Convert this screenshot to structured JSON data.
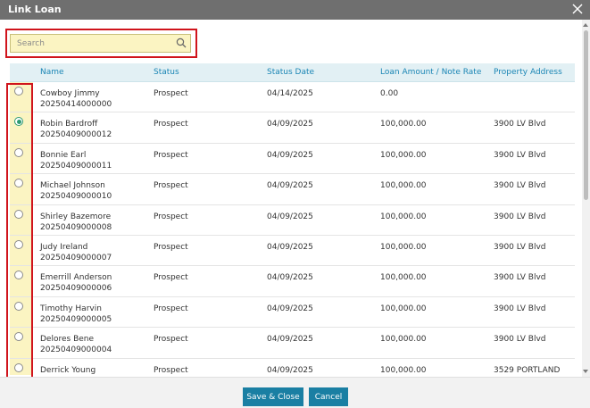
{
  "dialog": {
    "title": "Link Loan"
  },
  "search": {
    "placeholder": "Search"
  },
  "columns": {
    "name": "Name",
    "status": "Status",
    "status_date": "Status Date",
    "loan_amount": "Loan Amount / Note Rate",
    "property_address": "Property Address"
  },
  "rows": [
    {
      "name": "Cowboy Jimmy",
      "id": "20250414000000",
      "status": "Prospect",
      "date": "04/14/2025",
      "amount": "0.00",
      "address": "",
      "selected": false
    },
    {
      "name": "Robin Bardroff",
      "id": "20250409000012",
      "status": "Prospect",
      "date": "04/09/2025",
      "amount": "100,000.00",
      "address": "3900 LV Blvd",
      "selected": true
    },
    {
      "name": "Bonnie Earl",
      "id": "20250409000011",
      "status": "Prospect",
      "date": "04/09/2025",
      "amount": "100,000.00",
      "address": "3900 LV Blvd",
      "selected": false
    },
    {
      "name": "Michael Johnson",
      "id": "20250409000010",
      "status": "Prospect",
      "date": "04/09/2025",
      "amount": "100,000.00",
      "address": "3900 LV Blvd",
      "selected": false
    },
    {
      "name": "Shirley Bazemore",
      "id": "20250409000008",
      "status": "Prospect",
      "date": "04/09/2025",
      "amount": "100,000.00",
      "address": "3900 LV Blvd",
      "selected": false
    },
    {
      "name": "Judy Ireland",
      "id": "20250409000007",
      "status": "Prospect",
      "date": "04/09/2025",
      "amount": "100,000.00",
      "address": "3900 LV Blvd",
      "selected": false
    },
    {
      "name": "Emerrill Anderson",
      "id": "20250409000006",
      "status": "Prospect",
      "date": "04/09/2025",
      "amount": "100,000.00",
      "address": "3900 LV Blvd",
      "selected": false
    },
    {
      "name": "Timothy Harvin",
      "id": "20250409000005",
      "status": "Prospect",
      "date": "04/09/2025",
      "amount": "100,000.00",
      "address": "3900 LV Blvd",
      "selected": false
    },
    {
      "name": "Delores Bene",
      "id": "20250409000004",
      "status": "Prospect",
      "date": "04/09/2025",
      "amount": "100,000.00",
      "address": "3900 LV Blvd",
      "selected": false
    },
    {
      "name": "Derrick Young",
      "id": "",
      "status": "Prospect",
      "date": "04/09/2025",
      "amount": "100,000.00",
      "address": "3529 PORTLAND",
      "selected": false
    }
  ],
  "buttons": {
    "save_close": "Save & Close",
    "cancel": "Cancel"
  },
  "icons": {
    "close": "close-icon",
    "search": "search-icon"
  },
  "colors": {
    "accent": "#1a7fa3",
    "header_text": "#1b86b5",
    "highlight": "#fbf4c2",
    "annotation": "#d0141c",
    "selected_radio": "#2e9a72"
  }
}
